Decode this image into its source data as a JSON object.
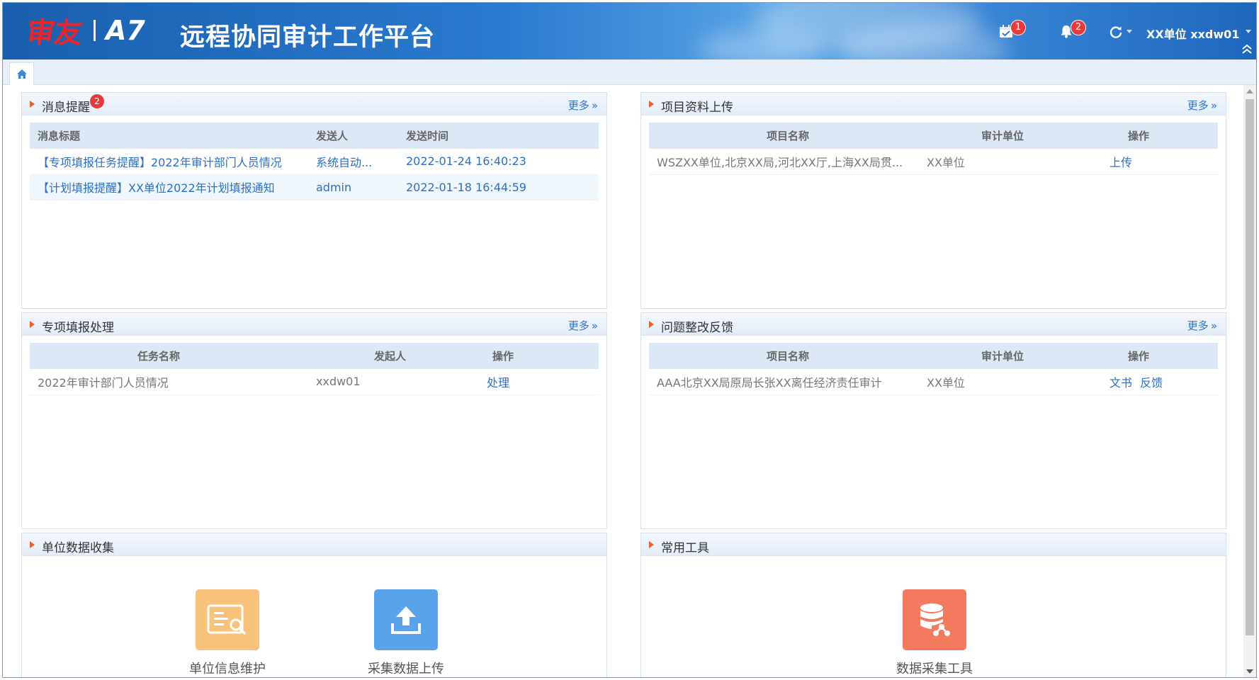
{
  "header": {
    "brand": "审友",
    "product": "A7",
    "title": "远程协同审计工作平台",
    "calendar_badge": "1",
    "bell_badge": "2",
    "user": "XX单位  xxdw01",
    "colors": {
      "bar": "#2a7ad0",
      "brand_red": "#e8262b",
      "badge": "#e83a3a"
    }
  },
  "tabs": {
    "home_icon": "home-icon"
  },
  "panels": {
    "messages": {
      "title": "消息提醒",
      "badge": "2",
      "more": "更多",
      "columns": [
        "消息标题",
        "发送人",
        "发送时间"
      ],
      "rows": [
        {
          "title": "【专项填报任务提醒】2022年审计部门人员情况",
          "sender": "系统自动...",
          "time": "2022-01-24 16:40:23"
        },
        {
          "title": "【计划填报提醒】XX单位2022年计划填报通知",
          "sender": "admin",
          "time": "2022-01-18 16:44:59"
        }
      ]
    },
    "upload": {
      "title": "项目资料上传",
      "more": "更多",
      "columns": [
        "项目名称",
        "审计单位",
        "操作"
      ],
      "rows": [
        {
          "name": "WSZXX单位,北京XX局,河北XX厅,上海XX局贯...",
          "unit": "XX单位",
          "action": "上传"
        }
      ]
    },
    "special": {
      "title": "专项填报处理",
      "more": "更多",
      "columns": [
        "任务名称",
        "发起人",
        "操作"
      ],
      "rows": [
        {
          "name": "2022年审计部门人员情况",
          "initiator": "xxdw01",
          "action": "处理"
        }
      ]
    },
    "issues": {
      "title": "问题整改反馈",
      "more": "更多",
      "columns": [
        "项目名称",
        "审计单位",
        "操作"
      ],
      "rows": [
        {
          "name": "AAA北京XX局原局长张XX离任经济责任审计",
          "unit": "XX单位",
          "action1": "文书",
          "action2": "反馈"
        }
      ]
    },
    "collect": {
      "title": "单位数据收集",
      "tools": [
        {
          "label": "单位信息维护",
          "icon": "info-card-icon",
          "color": "#f9c27a"
        },
        {
          "label": "采集数据上传",
          "icon": "upload-icon",
          "color": "#5aa3ea"
        }
      ]
    },
    "common_tools": {
      "title": "常用工具",
      "tools": [
        {
          "label": "数据采集工具",
          "icon": "database-share-icon",
          "color": "#f47a5f"
        }
      ]
    }
  }
}
